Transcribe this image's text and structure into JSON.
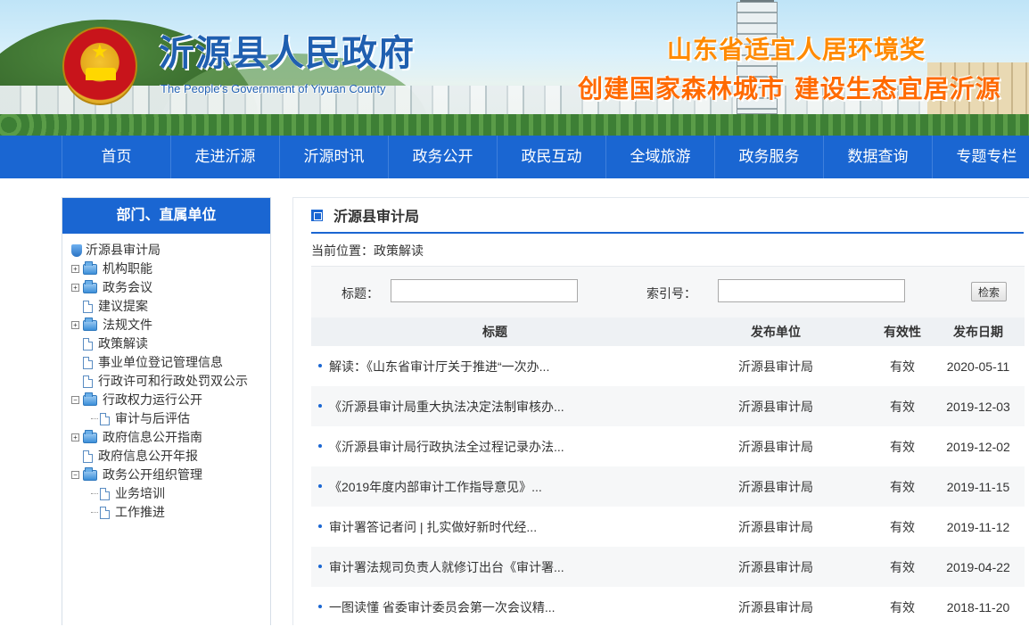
{
  "header": {
    "title": "沂源县人民政府",
    "subtitle": "The People's Government of Yiyuan County",
    "slogan_line1": "山东省适宜人居环境奖",
    "slogan_line2": "创建国家森林城市 建设生态宜居沂源"
  },
  "nav": {
    "items": [
      "首页",
      "走进沂源",
      "沂源时讯",
      "政务公开",
      "政民互动",
      "全域旅游",
      "政务服务",
      "数据查询",
      "专题专栏"
    ]
  },
  "sidebar": {
    "heading": "部门、直属单位",
    "root": "沂源县审计局",
    "items": [
      {
        "label": "机构职能",
        "type": "folder",
        "expander": "+"
      },
      {
        "label": "政务会议",
        "type": "folder",
        "expander": "+"
      },
      {
        "label": "建议提案",
        "type": "doc"
      },
      {
        "label": "法规文件",
        "type": "folder",
        "expander": "+"
      },
      {
        "label": "政策解读",
        "type": "doc"
      },
      {
        "label": "事业单位登记管理信息",
        "type": "doc"
      },
      {
        "label": "行政许可和行政处罚双公示",
        "type": "doc"
      },
      {
        "label": "行政权力运行公开",
        "type": "folder",
        "expander": "−"
      },
      {
        "label": "审计与后评估",
        "type": "doc-child"
      },
      {
        "label": "政府信息公开指南",
        "type": "folder",
        "expander": "+"
      },
      {
        "label": "政府信息公开年报",
        "type": "doc"
      },
      {
        "label": "政务公开组织管理",
        "type": "folder",
        "expander": "−"
      },
      {
        "label": "业务培训",
        "type": "doc-child"
      },
      {
        "label": "工作推进",
        "type": "doc-child"
      }
    ]
  },
  "main": {
    "heading": "沂源县审计局",
    "breadcrumb": "当前位置：政策解读",
    "search": {
      "title_label": "标题：",
      "title_value": "",
      "index_label": "索引号：",
      "index_value": "",
      "button": "检索"
    },
    "columns": [
      "标题",
      "发布单位",
      "有效性",
      "发布日期"
    ],
    "rows": [
      {
        "title": "解读：《山东省审计厅关于推进“一次办...",
        "unit": "沂源县审计局",
        "valid": "有效",
        "date": "2020-05-11"
      },
      {
        "title": "《沂源县审计局重大执法决定法制审核办...",
        "unit": "沂源县审计局",
        "valid": "有效",
        "date": "2019-12-03"
      },
      {
        "title": "《沂源县审计局行政执法全过程记录办法...",
        "unit": "沂源县审计局",
        "valid": "有效",
        "date": "2019-12-02"
      },
      {
        "title": "《2019年度内部审计工作指导意见》...",
        "unit": "沂源县审计局",
        "valid": "有效",
        "date": "2019-11-15"
      },
      {
        "title": "审计署答记者问 | 扎实做好新时代经...",
        "unit": "沂源县审计局",
        "valid": "有效",
        "date": "2019-11-12"
      },
      {
        "title": "审计署法规司负责人就修订出台《审计署...",
        "unit": "沂源县审计局",
        "valid": "有效",
        "date": "2019-04-22"
      },
      {
        "title": "一图读懂 省委审计委员会第一次会议精...",
        "unit": "沂源县审计局",
        "valid": "有效",
        "date": "2018-11-20"
      }
    ]
  }
}
